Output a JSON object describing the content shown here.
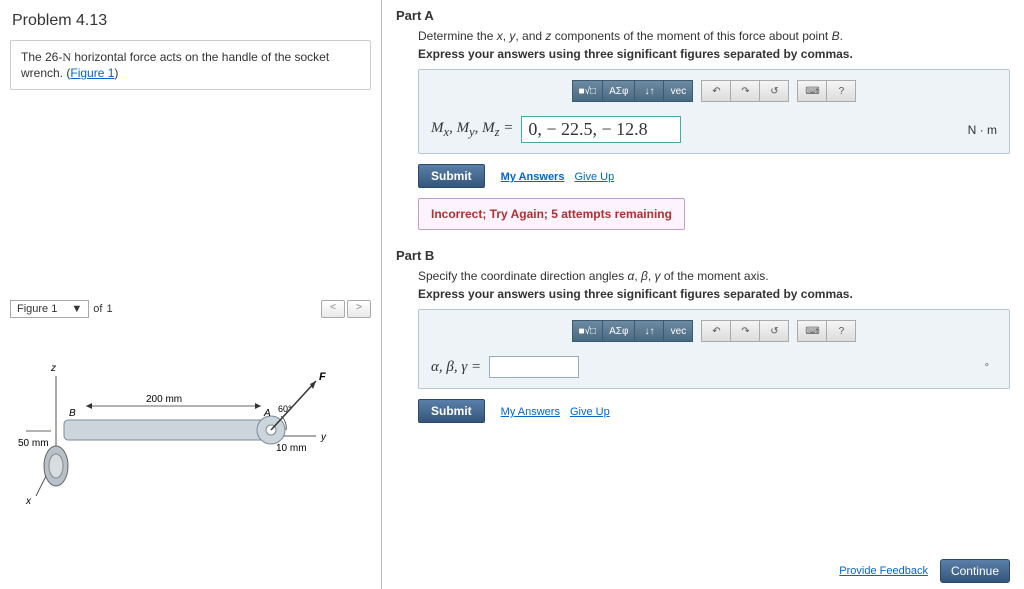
{
  "problem": {
    "title": "Problem 4.13",
    "description_pre": "The 26-",
    "description_force_unit": "N",
    "description_post": " horizontal force acts on the handle of the socket wrench. (",
    "figure_link": "Figure 1",
    "description_end": ")"
  },
  "figure_bar": {
    "select_label": "Figure 1",
    "of": "of",
    "total": "1",
    "prev": "<",
    "next": ">"
  },
  "figure": {
    "dim1": "200 mm",
    "dim2": "50 mm",
    "dim3": "10 mm",
    "angle": "60°",
    "axis_B": "B",
    "axis_A": "A",
    "axis_F": "F",
    "axis_y": "y",
    "axis_x": "x",
    "axis_z": "z"
  },
  "partA": {
    "title": "Part A",
    "desc_pre": "Determine the ",
    "var_x": "x",
    "desc_mid1": ", ",
    "var_y": "y",
    "desc_mid2": ", and ",
    "var_z": "z",
    "desc_post": " components of the moment of this force about point ",
    "point": "B",
    "desc_end": ".",
    "instruction": "Express your answers using three significant figures separated by commas.",
    "answer_label_html": "Mₓ, Mᵧ, M₍z₎ =",
    "answer_value": "0, − 22.5, − 12.8",
    "unit": "N · m",
    "submit": "Submit",
    "my_answers": "My Answers",
    "give_up": "Give Up",
    "feedback": "Incorrect; Try Again; 5 attempts remaining"
  },
  "partB": {
    "title": "Part B",
    "desc_pre": "Specify the coordinate direction angles ",
    "var_a": "α",
    "desc_mid1": ", ",
    "var_b": "β",
    "desc_mid2": ", ",
    "var_g": "γ",
    "desc_post": " of the moment axis.",
    "instruction": "Express your answers using three significant figures separated by commas.",
    "answer_label": "α, β, γ =",
    "answer_value": "",
    "unit_symbol": "°",
    "submit": "Submit",
    "my_answers": "My Answers",
    "give_up": "Give Up"
  },
  "toolbar": {
    "templates": "■√□",
    "greek": "ΑΣφ",
    "subsup": "↓↑",
    "vec": "vec",
    "undo": "↶",
    "redo": "↷",
    "reset": "↺",
    "keyboard": "⌨",
    "help": "?"
  },
  "footer": {
    "feedback_link": "Provide Feedback",
    "continue": "Continue"
  }
}
